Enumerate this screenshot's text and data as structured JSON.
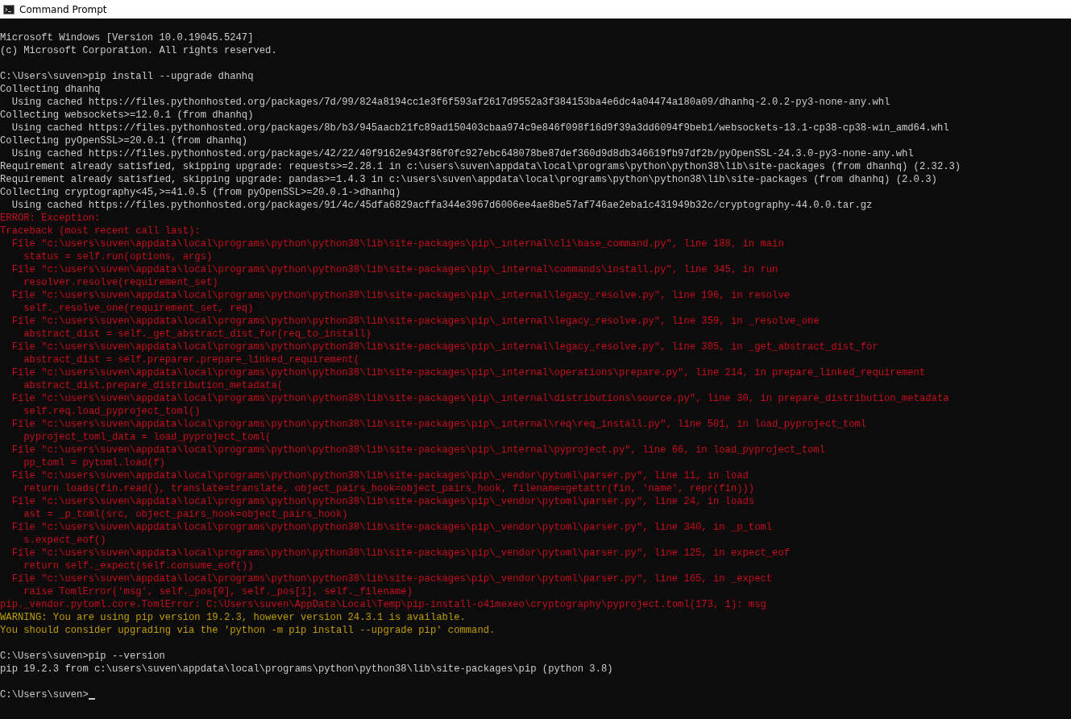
{
  "window": {
    "title": "Command Prompt"
  },
  "console": {
    "lines": [
      {
        "kind": "normal",
        "text": "Microsoft Windows [Version 10.0.19045.5247]"
      },
      {
        "kind": "normal",
        "text": "(c) Microsoft Corporation. All rights reserved."
      },
      {
        "kind": "blank"
      },
      {
        "kind": "normal",
        "text": "C:\\Users\\suven>pip install --upgrade dhanhq"
      },
      {
        "kind": "normal",
        "text": "Collecting dhanhq"
      },
      {
        "kind": "normal",
        "text": "  Using cached https://files.pythonhosted.org/packages/7d/99/824a8194cc1e3f6f593af2617d9552a3f384153ba4e6dc4a04474a180a09/dhanhq-2.0.2-py3-none-any.whl"
      },
      {
        "kind": "normal",
        "text": "Collecting websockets>=12.0.1 (from dhanhq)"
      },
      {
        "kind": "normal",
        "text": "  Using cached https://files.pythonhosted.org/packages/8b/b3/945aacb21fc89ad150403cbaa974c9e846f098f16d9f39a3dd6094f9beb1/websockets-13.1-cp38-cp38-win_amd64.whl"
      },
      {
        "kind": "normal",
        "text": "Collecting pyOpenSSL>=20.0.1 (from dhanhq)"
      },
      {
        "kind": "normal",
        "text": "  Using cached https://files.pythonhosted.org/packages/42/22/40f9162e943f86f0fc927ebc648078be87def360d9d8db346619fb97df2b/pyOpenSSL-24.3.0-py3-none-any.whl"
      },
      {
        "kind": "normal",
        "text": "Requirement already satisfied, skipping upgrade: requests>=2.28.1 in c:\\users\\suven\\appdata\\local\\programs\\python\\python38\\lib\\site-packages (from dhanhq) (2.32.3)"
      },
      {
        "kind": "normal",
        "text": "Requirement already satisfied, skipping upgrade: pandas>=1.4.3 in c:\\users\\suven\\appdata\\local\\programs\\python\\python38\\lib\\site-packages (from dhanhq) (2.0.3)"
      },
      {
        "kind": "normal",
        "text": "Collecting cryptography<45,>=41.0.5 (from pyOpenSSL>=20.0.1->dhanhq)"
      },
      {
        "kind": "normal",
        "text": "  Using cached https://files.pythonhosted.org/packages/91/4c/45dfa6829acffa344e3967d6006ee4ae8be57af746ae2eba1c431949b32c/cryptography-44.0.0.tar.gz"
      },
      {
        "kind": "error",
        "text": "ERROR: Exception:"
      },
      {
        "kind": "error",
        "text": "Traceback (most recent call last):"
      },
      {
        "kind": "error",
        "text": "  File \"c:\\users\\suven\\appdata\\local\\programs\\python\\python38\\lib\\site-packages\\pip\\_internal\\cli\\base_command.py\", line 188, in main"
      },
      {
        "kind": "error",
        "text": "    status = self.run(options, args)"
      },
      {
        "kind": "error",
        "text": "  File \"c:\\users\\suven\\appdata\\local\\programs\\python\\python38\\lib\\site-packages\\pip\\_internal\\commands\\install.py\", line 345, in run"
      },
      {
        "kind": "error",
        "text": "    resolver.resolve(requirement_set)"
      },
      {
        "kind": "error",
        "text": "  File \"c:\\users\\suven\\appdata\\local\\programs\\python\\python38\\lib\\site-packages\\pip\\_internal\\legacy_resolve.py\", line 196, in resolve"
      },
      {
        "kind": "error",
        "text": "    self._resolve_one(requirement_set, req)"
      },
      {
        "kind": "error",
        "text": "  File \"c:\\users\\suven\\appdata\\local\\programs\\python\\python38\\lib\\site-packages\\pip\\_internal\\legacy_resolve.py\", line 359, in _resolve_one"
      },
      {
        "kind": "error",
        "text": "    abstract_dist = self._get_abstract_dist_for(req_to_install)"
      },
      {
        "kind": "error",
        "text": "  File \"c:\\users\\suven\\appdata\\local\\programs\\python\\python38\\lib\\site-packages\\pip\\_internal\\legacy_resolve.py\", line 305, in _get_abstract_dist_for"
      },
      {
        "kind": "error",
        "text": "    abstract_dist = self.preparer.prepare_linked_requirement("
      },
      {
        "kind": "error",
        "text": "  File \"c:\\users\\suven\\appdata\\local\\programs\\python\\python38\\lib\\site-packages\\pip\\_internal\\operations\\prepare.py\", line 214, in prepare_linked_requirement"
      },
      {
        "kind": "error",
        "text": "    abstract_dist.prepare_distribution_metadata("
      },
      {
        "kind": "error",
        "text": "  File \"c:\\users\\suven\\appdata\\local\\programs\\python\\python38\\lib\\site-packages\\pip\\_internal\\distributions\\source.py\", line 30, in prepare_distribution_metadata"
      },
      {
        "kind": "error",
        "text": "    self.req.load_pyproject_toml()"
      },
      {
        "kind": "error",
        "text": "  File \"c:\\users\\suven\\appdata\\local\\programs\\python\\python38\\lib\\site-packages\\pip\\_internal\\req\\req_install.py\", line 501, in load_pyproject_toml"
      },
      {
        "kind": "error",
        "text": "    pyproject_toml_data = load_pyproject_toml("
      },
      {
        "kind": "error",
        "text": "  File \"c:\\users\\suven\\appdata\\local\\programs\\python\\python38\\lib\\site-packages\\pip\\_internal\\pyproject.py\", line 66, in load_pyproject_toml"
      },
      {
        "kind": "error",
        "text": "    pp_toml = pytoml.load(f)"
      },
      {
        "kind": "error",
        "text": "  File \"c:\\users\\suven\\appdata\\local\\programs\\python\\python38\\lib\\site-packages\\pip\\_vendor\\pytoml\\parser.py\", line 11, in load"
      },
      {
        "kind": "error",
        "text": "    return loads(fin.read(), translate=translate, object_pairs_hook=object_pairs_hook, filename=getattr(fin, 'name', repr(fin)))"
      },
      {
        "kind": "error",
        "text": "  File \"c:\\users\\suven\\appdata\\local\\programs\\python\\python38\\lib\\site-packages\\pip\\_vendor\\pytoml\\parser.py\", line 24, in loads"
      },
      {
        "kind": "error",
        "text": "    ast = _p_toml(src, object_pairs_hook=object_pairs_hook)"
      },
      {
        "kind": "error",
        "text": "  File \"c:\\users\\suven\\appdata\\local\\programs\\python\\python38\\lib\\site-packages\\pip\\_vendor\\pytoml\\parser.py\", line 340, in _p_toml"
      },
      {
        "kind": "error",
        "text": "    s.expect_eof()"
      },
      {
        "kind": "error",
        "text": "  File \"c:\\users\\suven\\appdata\\local\\programs\\python\\python38\\lib\\site-packages\\pip\\_vendor\\pytoml\\parser.py\", line 125, in expect_eof"
      },
      {
        "kind": "error",
        "text": "    return self._expect(self.consume_eof())"
      },
      {
        "kind": "error",
        "text": "  File \"c:\\users\\suven\\appdata\\local\\programs\\python\\python38\\lib\\site-packages\\pip\\_vendor\\pytoml\\parser.py\", line 165, in _expect"
      },
      {
        "kind": "error",
        "text": "    raise TomlError('msg', self._pos[0], self._pos[1], self._filename)"
      },
      {
        "kind": "error",
        "text": "pip._vendor.pytoml.core.TomlError: C:\\Users\\suven\\AppData\\Local\\Temp\\pip-install-o41mexeo\\cryptography\\pyproject.toml(173, 1): msg"
      },
      {
        "kind": "warning",
        "text": "WARNING: You are using pip version 19.2.3, however version 24.3.1 is available."
      },
      {
        "kind": "warning",
        "text": "You should consider upgrading via the 'python -m pip install --upgrade pip' command."
      },
      {
        "kind": "blank"
      },
      {
        "kind": "normal",
        "text": "C:\\Users\\suven>pip --version"
      },
      {
        "kind": "normal",
        "text": "pip 19.2.3 from c:\\users\\suven\\appdata\\local\\programs\\python\\python38\\lib\\site-packages\\pip (python 3.8)"
      },
      {
        "kind": "blank"
      },
      {
        "kind": "normal",
        "text": "C:\\Users\\suven>",
        "cursor": true
      }
    ]
  }
}
